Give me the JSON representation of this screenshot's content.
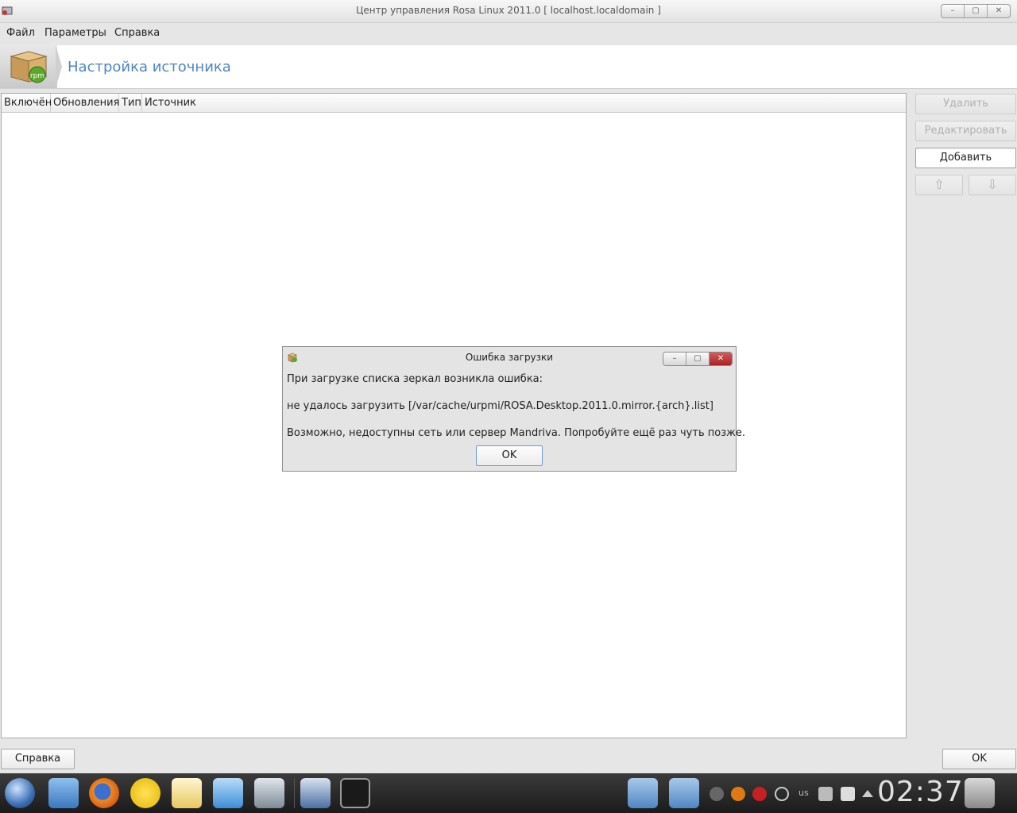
{
  "window": {
    "title": "Центр управления Rosa Linux 2011.0 [ localhost.localdomain ]",
    "controls": {
      "minimize": "–",
      "maximize": "▢",
      "close": "✕"
    }
  },
  "menu": [
    "Файл",
    "Параметры",
    "Справка"
  ],
  "header": {
    "title": "Настройка источника",
    "icon": "rpm-package-icon"
  },
  "table": {
    "columns": [
      "Включён",
      "Обновления",
      "Тип",
      "Источник"
    ],
    "rows": []
  },
  "side_buttons": {
    "delete": "Удалить",
    "edit": "Редактировать",
    "add": "Добавить",
    "up": "⇧",
    "down": "⇩"
  },
  "bottom_buttons": {
    "help": "Справка",
    "ok": "OK"
  },
  "dialog": {
    "title": "Ошибка загрузки",
    "line1": "При загрузке списка зеркал возникла ошибка:",
    "line2": "не удалось загрузить [/var/cache/urpmi/ROSA.Desktop.2011.0.mirror.{arch}.list]",
    "line3": "Возможно, недоступны сеть или сервер Mandriva. Попробуйте ещё раз чуть позже.",
    "ok": "OK",
    "controls": {
      "minimize": "–",
      "maximize": "▢",
      "close": "✕"
    }
  },
  "taskbar": {
    "keyboard_layout": "us",
    "clock": "02:37"
  }
}
